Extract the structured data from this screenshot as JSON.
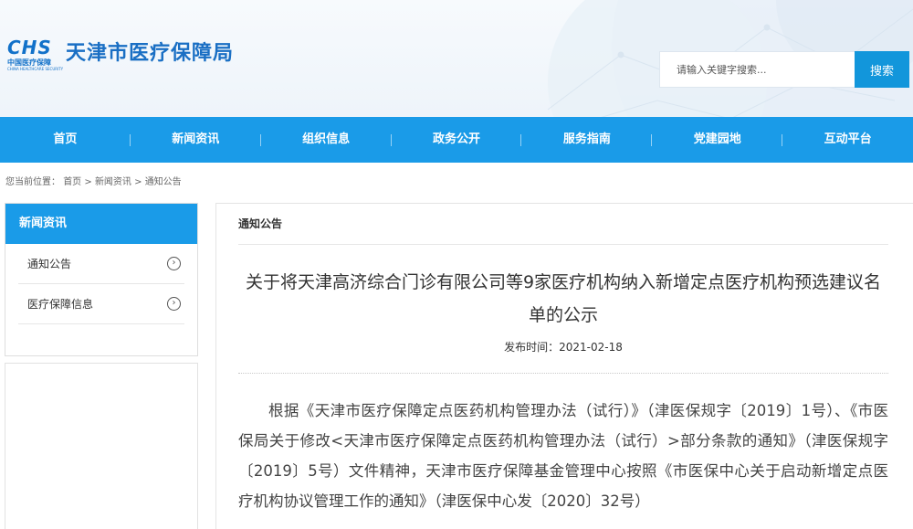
{
  "header": {
    "logo_text": "CHS",
    "logo_cn": "中国医疗保障",
    "logo_en": "CHINA HEALTHCARE SECURITY",
    "site_title": "天津市医疗保障局",
    "search_placeholder": "请输入关键字搜索...",
    "search_button": "搜索"
  },
  "nav": {
    "items": [
      "首页",
      "新闻资讯",
      "组织信息",
      "政务公开",
      "服务指南",
      "党建园地",
      "互动平台"
    ]
  },
  "breadcrumb": {
    "prefix": "您当前位置：",
    "items": [
      "首页",
      "新闻资讯",
      "通知公告"
    ],
    "separator": " > "
  },
  "sidebar": {
    "title": "新闻资讯",
    "items": [
      {
        "label": "通知公告",
        "icon": "chevron-right-circle-icon"
      },
      {
        "label": "医疗保障信息",
        "icon": "chevron-right-circle-icon"
      }
    ]
  },
  "article": {
    "section": "通知公告",
    "title": "关于将天津高济综合门诊有限公司等9家医疗机构纳入新增定点医疗机构预选建议名单的公示",
    "publish_label": "发布时间：",
    "publish_date": "2021-02-18",
    "body": "根据《天津市医疗保障定点医药机构管理办法（试行）》（津医保规字〔2019〕1号）、《市医保局关于修改<天津市医疗保障定点医药机构管理办法（试行）>部分条款的通知》（津医保规字〔2019〕5号）文件精神，天津市医疗保障基金管理中心按照《市医保中心关于启动新增定点医疗机构协议管理工作的通知》（津医保中心发〔2020〕32号）"
  },
  "colors": {
    "primary": "#1a9be8",
    "title_blue": "#1a6fc4",
    "search_button": "#1296db"
  }
}
